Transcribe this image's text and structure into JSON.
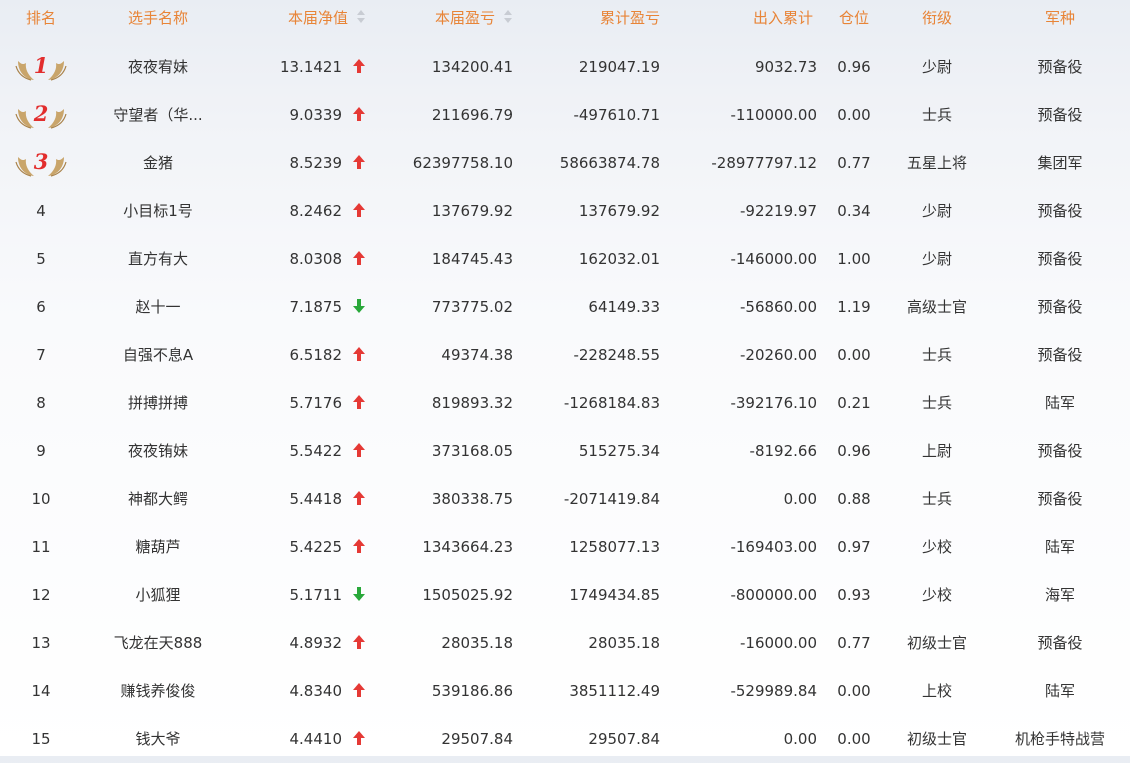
{
  "headers": {
    "rank": "排名",
    "name": "选手名称",
    "nav": "本届净值",
    "cur_pnl": "本届盈亏",
    "total_pnl": "累计盈亏",
    "io_total": "出入累计",
    "position": "仓位",
    "grade": "衔级",
    "army": "军种"
  },
  "colors": {
    "header_text": "#e88437",
    "up": "#e53935",
    "down": "#29a83a",
    "medal_number": "#e22d2d",
    "wing": "#c9a56b"
  },
  "rows": [
    {
      "rank": "1",
      "medal": true,
      "name": "夜夜宥妹",
      "nav": "13.1421",
      "trend": "up",
      "cur": "134200.41",
      "total": "219047.19",
      "io": "9032.73",
      "pos": "0.96",
      "grade": "少尉",
      "army": "预备役"
    },
    {
      "rank": "2",
      "medal": true,
      "name": "守望者（华...",
      "nav": "9.0339",
      "trend": "up",
      "cur": "211696.79",
      "total": "-497610.71",
      "io": "-110000.00",
      "pos": "0.00",
      "grade": "士兵",
      "army": "预备役"
    },
    {
      "rank": "3",
      "medal": true,
      "name": "金猪",
      "nav": "8.5239",
      "trend": "up",
      "cur": "62397758.10",
      "total": "58663874.78",
      "io": "-28977797.12",
      "pos": "0.77",
      "grade": "五星上将",
      "army": "集团军"
    },
    {
      "rank": "4",
      "medal": false,
      "name": "小目标1号",
      "nav": "8.2462",
      "trend": "up",
      "cur": "137679.92",
      "total": "137679.92",
      "io": "-92219.97",
      "pos": "0.34",
      "grade": "少尉",
      "army": "预备役"
    },
    {
      "rank": "5",
      "medal": false,
      "name": "直方有大",
      "nav": "8.0308",
      "trend": "up",
      "cur": "184745.43",
      "total": "162032.01",
      "io": "-146000.00",
      "pos": "1.00",
      "grade": "少尉",
      "army": "预备役"
    },
    {
      "rank": "6",
      "medal": false,
      "name": "赵十一",
      "nav": "7.1875",
      "trend": "down",
      "cur": "773775.02",
      "total": "64149.33",
      "io": "-56860.00",
      "pos": "1.19",
      "grade": "高级士官",
      "army": "预备役"
    },
    {
      "rank": "7",
      "medal": false,
      "name": "自强不息A",
      "nav": "6.5182",
      "trend": "up",
      "cur": "49374.38",
      "total": "-228248.55",
      "io": "-20260.00",
      "pos": "0.00",
      "grade": "士兵",
      "army": "预备役"
    },
    {
      "rank": "8",
      "medal": false,
      "name": "拼搏拼搏",
      "nav": "5.7176",
      "trend": "up",
      "cur": "819893.32",
      "total": "-1268184.83",
      "io": "-392176.10",
      "pos": "0.21",
      "grade": "士兵",
      "army": "陆军"
    },
    {
      "rank": "9",
      "medal": false,
      "name": "夜夜铕妹",
      "nav": "5.5422",
      "trend": "up",
      "cur": "373168.05",
      "total": "515275.34",
      "io": "-8192.66",
      "pos": "0.96",
      "grade": "上尉",
      "army": "预备役"
    },
    {
      "rank": "10",
      "medal": false,
      "name": "神都大鳄",
      "nav": "5.4418",
      "trend": "up",
      "cur": "380338.75",
      "total": "-2071419.84",
      "io": "0.00",
      "pos": "0.88",
      "grade": "士兵",
      "army": "预备役"
    },
    {
      "rank": "11",
      "medal": false,
      "name": "糖葫芦",
      "nav": "5.4225",
      "trend": "up",
      "cur": "1343664.23",
      "total": "1258077.13",
      "io": "-169403.00",
      "pos": "0.97",
      "grade": "少校",
      "army": "陆军"
    },
    {
      "rank": "12",
      "medal": false,
      "name": "小狐狸",
      "nav": "5.1711",
      "trend": "down",
      "cur": "1505025.92",
      "total": "1749434.85",
      "io": "-800000.00",
      "pos": "0.93",
      "grade": "少校",
      "army": "海军"
    },
    {
      "rank": "13",
      "medal": false,
      "name": "飞龙在天888",
      "nav": "4.8932",
      "trend": "up",
      "cur": "28035.18",
      "total": "28035.18",
      "io": "-16000.00",
      "pos": "0.77",
      "grade": "初级士官",
      "army": "预备役"
    },
    {
      "rank": "14",
      "medal": false,
      "name": "赚钱养俊俊",
      "nav": "4.8340",
      "trend": "up",
      "cur": "539186.86",
      "total": "3851112.49",
      "io": "-529989.84",
      "pos": "0.00",
      "grade": "上校",
      "army": "陆军"
    },
    {
      "rank": "15",
      "medal": false,
      "name": "钱大爷",
      "nav": "4.4410",
      "trend": "up",
      "cur": "29507.84",
      "total": "29507.84",
      "io": "0.00",
      "pos": "0.00",
      "grade": "初级士官",
      "army": "机枪手特战营"
    }
  ]
}
